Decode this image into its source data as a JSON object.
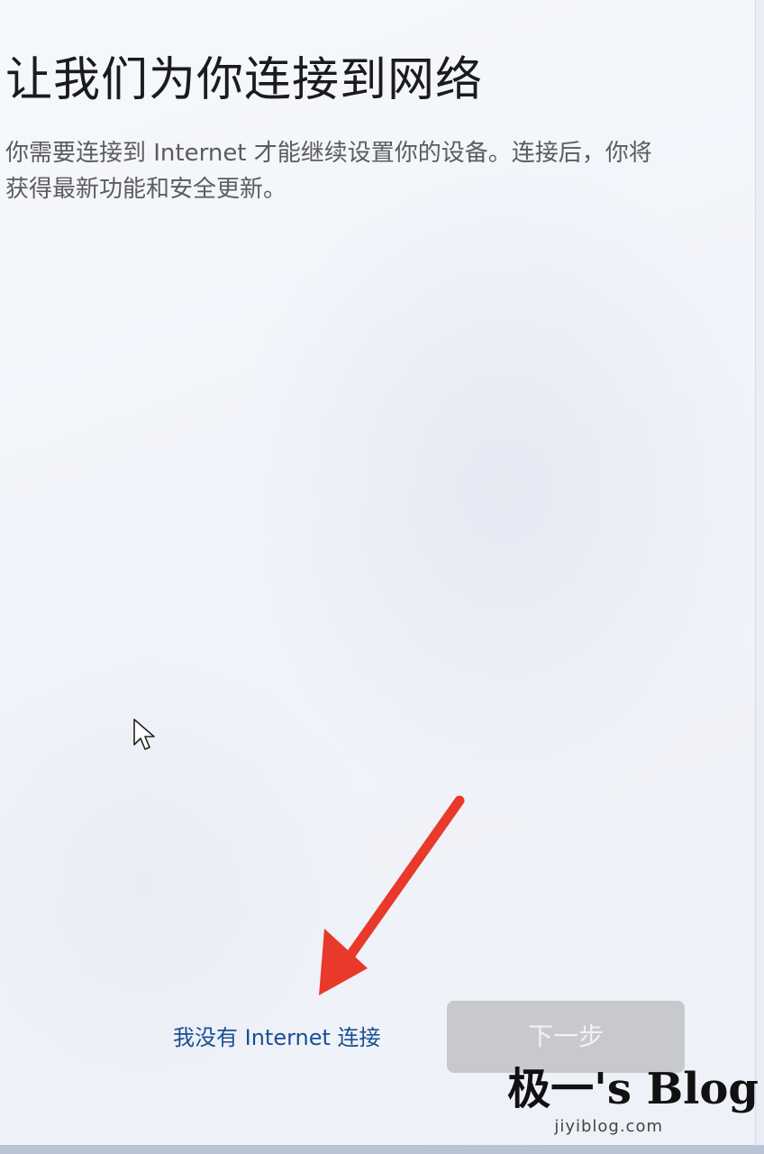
{
  "page": {
    "title": "让我们为你连接到网络",
    "description": "你需要连接到 Internet 才能继续设置你的设备。连接后，你将获得最新功能和安全更新。"
  },
  "actions": {
    "no_internet_label": "我没有 Internet 连接",
    "next_label": "下一步",
    "next_enabled": false
  },
  "annotation": {
    "arrow_color": "#e8392a"
  },
  "watermark": {
    "brand": "极一's Blog",
    "url": "jiyiblog.com"
  },
  "colors": {
    "link": "#1a4f94",
    "button_disabled_bg": "#c7c9cd",
    "button_disabled_text": "#f1f2f4",
    "title_text": "#1b1b1b",
    "body_text": "#5c5c5c"
  },
  "icons": {
    "cursor": "mouse-pointer-icon",
    "annotation": "red-arrow-icon"
  }
}
